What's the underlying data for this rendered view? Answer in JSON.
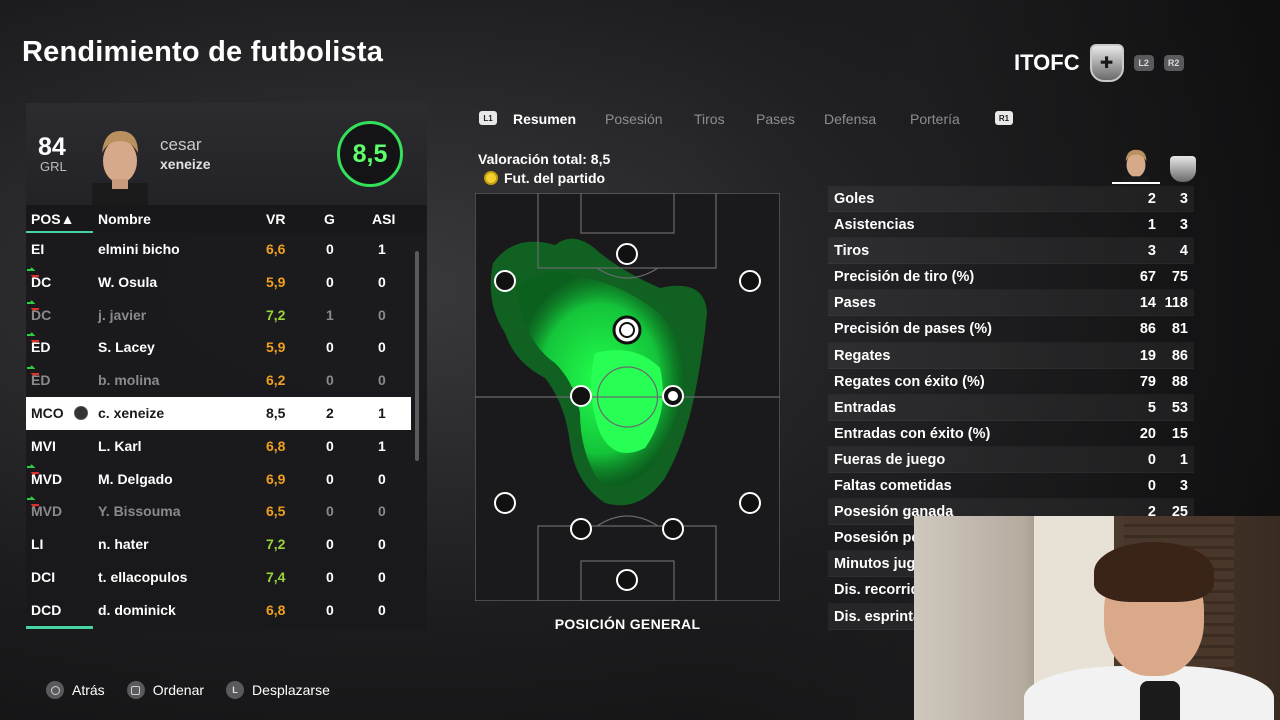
{
  "page_title": "Rendimiento de futbolista",
  "club": {
    "name": "ITOFC",
    "badges": [
      "L2",
      "R2"
    ]
  },
  "player_card": {
    "overall": "84",
    "overall_label": "GRL",
    "first_name": "cesar",
    "last_name": "xeneize",
    "rating": "8,5",
    "rating_color": "#34e05a"
  },
  "table": {
    "headers": {
      "pos": "POS▲",
      "name": "Nombre",
      "vr": "VR",
      "g": "G",
      "asi": "ASI"
    },
    "rows": [
      {
        "pos": "EI",
        "name": "elmini bicho",
        "vr": "6,6",
        "g": "0",
        "asi": "1",
        "vr_tone": "orange",
        "trend": false,
        "dim": false
      },
      {
        "pos": "DC",
        "name": "W. Osula",
        "vr": "5,9",
        "g": "0",
        "asi": "0",
        "vr_tone": "orange",
        "trend": true,
        "dim": false
      },
      {
        "pos": "DC",
        "name": "j. javier",
        "vr": "7,2",
        "g": "1",
        "asi": "0",
        "vr_tone": "green",
        "trend": true,
        "dim": true
      },
      {
        "pos": "ED",
        "name": "S. Lacey",
        "vr": "5,9",
        "g": "0",
        "asi": "0",
        "vr_tone": "orange",
        "trend": true,
        "dim": false
      },
      {
        "pos": "ED",
        "name": "b. molina",
        "vr": "6,2",
        "g": "0",
        "asi": "0",
        "vr_tone": "orange",
        "trend": true,
        "dim": true
      },
      {
        "pos": "MCO",
        "name": "c. xeneize",
        "vr": "8,5",
        "g": "2",
        "asi": "1",
        "vr_tone": "plain",
        "trend": false,
        "dim": false,
        "selected": true
      },
      {
        "pos": "MVI",
        "name": "L. Karl",
        "vr": "6,8",
        "g": "0",
        "asi": "1",
        "vr_tone": "orange",
        "trend": false,
        "dim": false
      },
      {
        "pos": "MVD",
        "name": "M. Delgado",
        "vr": "6,9",
        "g": "0",
        "asi": "0",
        "vr_tone": "orange",
        "trend": true,
        "dim": false
      },
      {
        "pos": "MVD",
        "name": "Y. Bissouma",
        "vr": "6,5",
        "g": "0",
        "asi": "0",
        "vr_tone": "orange",
        "trend": true,
        "dim": true
      },
      {
        "pos": "LI",
        "name": "n. hater",
        "vr": "7,2",
        "g": "0",
        "asi": "0",
        "vr_tone": "green",
        "trend": false,
        "dim": false
      },
      {
        "pos": "DCI",
        "name": "t. ellacopulos",
        "vr": "7,4",
        "g": "0",
        "asi": "0",
        "vr_tone": "green",
        "trend": false,
        "dim": false
      },
      {
        "pos": "DCD",
        "name": "d. dominick",
        "vr": "6,8",
        "g": "0",
        "asi": "0",
        "vr_tone": "orange",
        "trend": false,
        "dim": false
      }
    ]
  },
  "tabs": {
    "left_badge": "L1",
    "right_badge": "R1",
    "items": [
      "Resumen",
      "Posesión",
      "Tiros",
      "Pases",
      "Defensa",
      "Portería"
    ],
    "active": 0
  },
  "summary": {
    "total_rating": "Valoración total: 8,5",
    "motm": "Fut. del partido"
  },
  "pitch": {
    "label": "POSICIÓN GENERAL",
    "heatmap_color": "#1fd84a"
  },
  "stats": [
    {
      "label": "Goles",
      "a": "2",
      "b": "3"
    },
    {
      "label": "Asistencias",
      "a": "1",
      "b": "3"
    },
    {
      "label": "Tiros",
      "a": "3",
      "b": "4"
    },
    {
      "label": "Precisión de tiro (%)",
      "a": "67",
      "b": "75"
    },
    {
      "label": "Pases",
      "a": "14",
      "b": "118"
    },
    {
      "label": "Precisión de pases (%)",
      "a": "86",
      "b": "81"
    },
    {
      "label": "Regates",
      "a": "19",
      "b": "86"
    },
    {
      "label": "Regates con éxito (%)",
      "a": "79",
      "b": "88"
    },
    {
      "label": "Entradas",
      "a": "5",
      "b": "53"
    },
    {
      "label": "Entradas con éxito (%)",
      "a": "20",
      "b": "15"
    },
    {
      "label": "Fueras de juego",
      "a": "0",
      "b": "1"
    },
    {
      "label": "Faltas cometidas",
      "a": "0",
      "b": "3"
    },
    {
      "label": "Posesión ganada",
      "a": "2",
      "b": "25"
    },
    {
      "label": "Posesión pe",
      "a": "",
      "b": ""
    },
    {
      "label": "Minutos jug",
      "a": "",
      "b": ""
    },
    {
      "label": "Dis. recorrid",
      "a": "",
      "b": ""
    },
    {
      "label": "Dis. esprinta",
      "a": "",
      "b": ""
    }
  ],
  "footer": {
    "back": "Atrás",
    "sort": "Ordenar",
    "scroll": "Desplazarse",
    "scroll_button": "L"
  }
}
